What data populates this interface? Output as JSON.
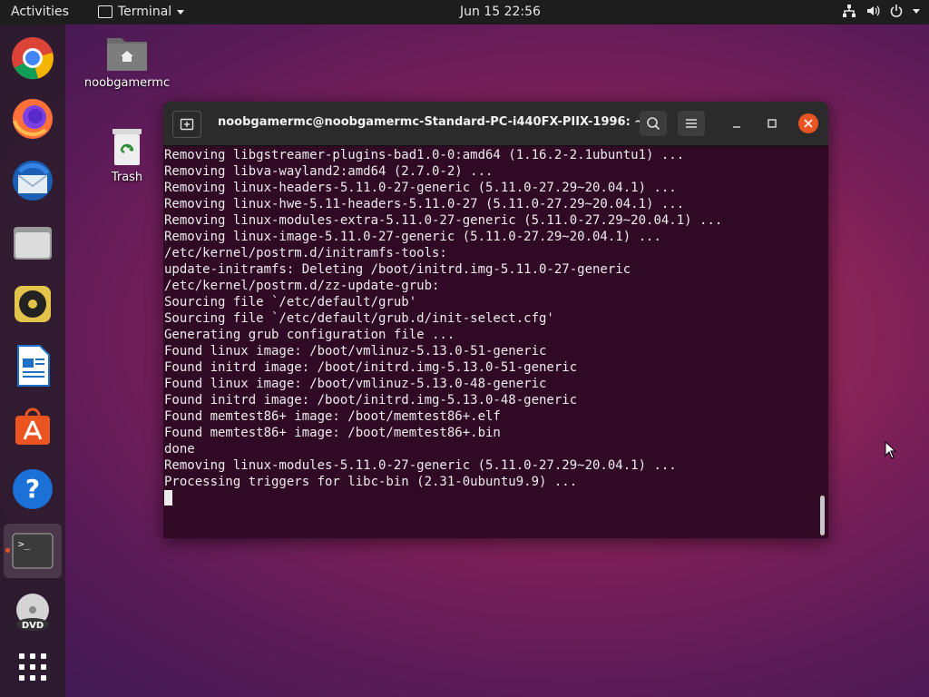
{
  "topbar": {
    "activities": "Activities",
    "app_name": "Terminal",
    "clock": "Jun 15  22:56",
    "icons": [
      "network-icon",
      "volume-icon",
      "power-icon",
      "chevron-down-icon"
    ]
  },
  "dock": {
    "items": [
      {
        "name": "chrome",
        "icon": "chrome-icon"
      },
      {
        "name": "firefox",
        "icon": "firefox-icon"
      },
      {
        "name": "thunderbird",
        "icon": "thunderbird-icon"
      },
      {
        "name": "files",
        "icon": "files-icon"
      },
      {
        "name": "rhythmbox",
        "icon": "rhythmbox-icon"
      },
      {
        "name": "writer",
        "icon": "writer-icon"
      },
      {
        "name": "software",
        "icon": "software-icon"
      },
      {
        "name": "help",
        "icon": "help-icon"
      },
      {
        "name": "terminal",
        "icon": "terminal-icon",
        "running": true
      },
      {
        "name": "dvd",
        "icon": "dvd-icon"
      },
      {
        "name": "show-apps",
        "icon": "grid-icon"
      }
    ]
  },
  "desktop": {
    "home_label": "noobgamermc",
    "trash_label": "Trash"
  },
  "terminal": {
    "title": "noobgamermc@noobgamermc-Standard-PC-i440FX-PIIX-1996: ~",
    "lines": [
      "Removing libgstreamer-plugins-bad1.0-0:amd64 (1.16.2-2.1ubuntu1) ...",
      "Removing libva-wayland2:amd64 (2.7.0-2) ...",
      "Removing linux-headers-5.11.0-27-generic (5.11.0-27.29~20.04.1) ...",
      "Removing linux-hwe-5.11-headers-5.11.0-27 (5.11.0-27.29~20.04.1) ...",
      "Removing linux-modules-extra-5.11.0-27-generic (5.11.0-27.29~20.04.1) ...",
      "Removing linux-image-5.11.0-27-generic (5.11.0-27.29~20.04.1) ...",
      "/etc/kernel/postrm.d/initramfs-tools:",
      "update-initramfs: Deleting /boot/initrd.img-5.11.0-27-generic",
      "/etc/kernel/postrm.d/zz-update-grub:",
      "Sourcing file `/etc/default/grub'",
      "Sourcing file `/etc/default/grub.d/init-select.cfg'",
      "Generating grub configuration file ...",
      "Found linux image: /boot/vmlinuz-5.13.0-51-generic",
      "Found initrd image: /boot/initrd.img-5.13.0-51-generic",
      "Found linux image: /boot/vmlinuz-5.13.0-48-generic",
      "Found initrd image: /boot/initrd.img-5.13.0-48-generic",
      "Found memtest86+ image: /boot/memtest86+.elf",
      "Found memtest86+ image: /boot/memtest86+.bin",
      "done",
      "Removing linux-modules-5.11.0-27-generic (5.11.0-27.29~20.04.1) ...",
      "Processing triggers for libc-bin (2.31-0ubuntu9.9) ..."
    ]
  },
  "colors": {
    "terminal_bg": "#300a24",
    "close_button": "#e95420"
  }
}
